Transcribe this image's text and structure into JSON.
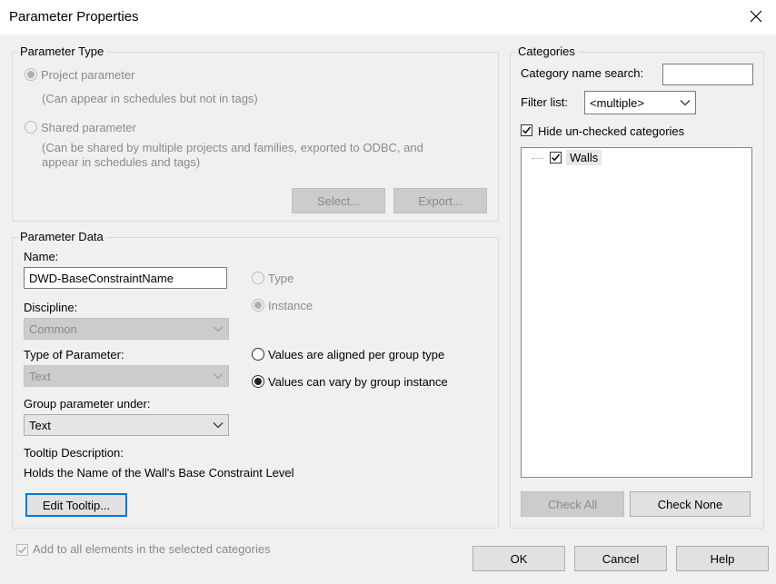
{
  "window": {
    "title": "Parameter Properties"
  },
  "parameter_type": {
    "legend": "Parameter Type",
    "project_label": "Project parameter",
    "project_note": "(Can appear in schedules but not in tags)",
    "shared_label": "Shared parameter",
    "shared_note_line1": "(Can be shared by multiple projects and families, exported to ODBC, and",
    "shared_note_line2": "appear in schedules and tags)",
    "select_button": "Select...",
    "export_button": "Export..."
  },
  "parameter_data": {
    "legend": "Parameter Data",
    "name_label": "Name:",
    "name_value": "DWD-BaseConstraintName",
    "discipline_label": "Discipline:",
    "discipline_value": "Common",
    "type_of_parameter_label": "Type of Parameter:",
    "type_of_parameter_value": "Text",
    "group_label": "Group parameter under:",
    "group_value": "Text",
    "type_radio": "Type",
    "instance_radio": "Instance",
    "aligned_radio": "Values are aligned per group type",
    "vary_radio": "Values can vary by group instance",
    "tooltip_label": "Tooltip Description:",
    "tooltip_text": "Holds the Name of the Wall's Base Constraint Level",
    "edit_tooltip_button": "Edit Tooltip..."
  },
  "categories": {
    "legend": "Categories",
    "search_label": "Category name search:",
    "search_value": "",
    "filter_label": "Filter list:",
    "filter_value": "<multiple>",
    "hide_unchecked_label": "Hide un-checked categories",
    "tree_items": [
      {
        "label": "Walls",
        "checked": true
      }
    ],
    "check_all_button": "Check All",
    "check_none_button": "Check None"
  },
  "footer": {
    "add_to_all_label": "Add to all elements in the selected categories",
    "ok_button": "OK",
    "cancel_button": "Cancel",
    "help_button": "Help"
  }
}
